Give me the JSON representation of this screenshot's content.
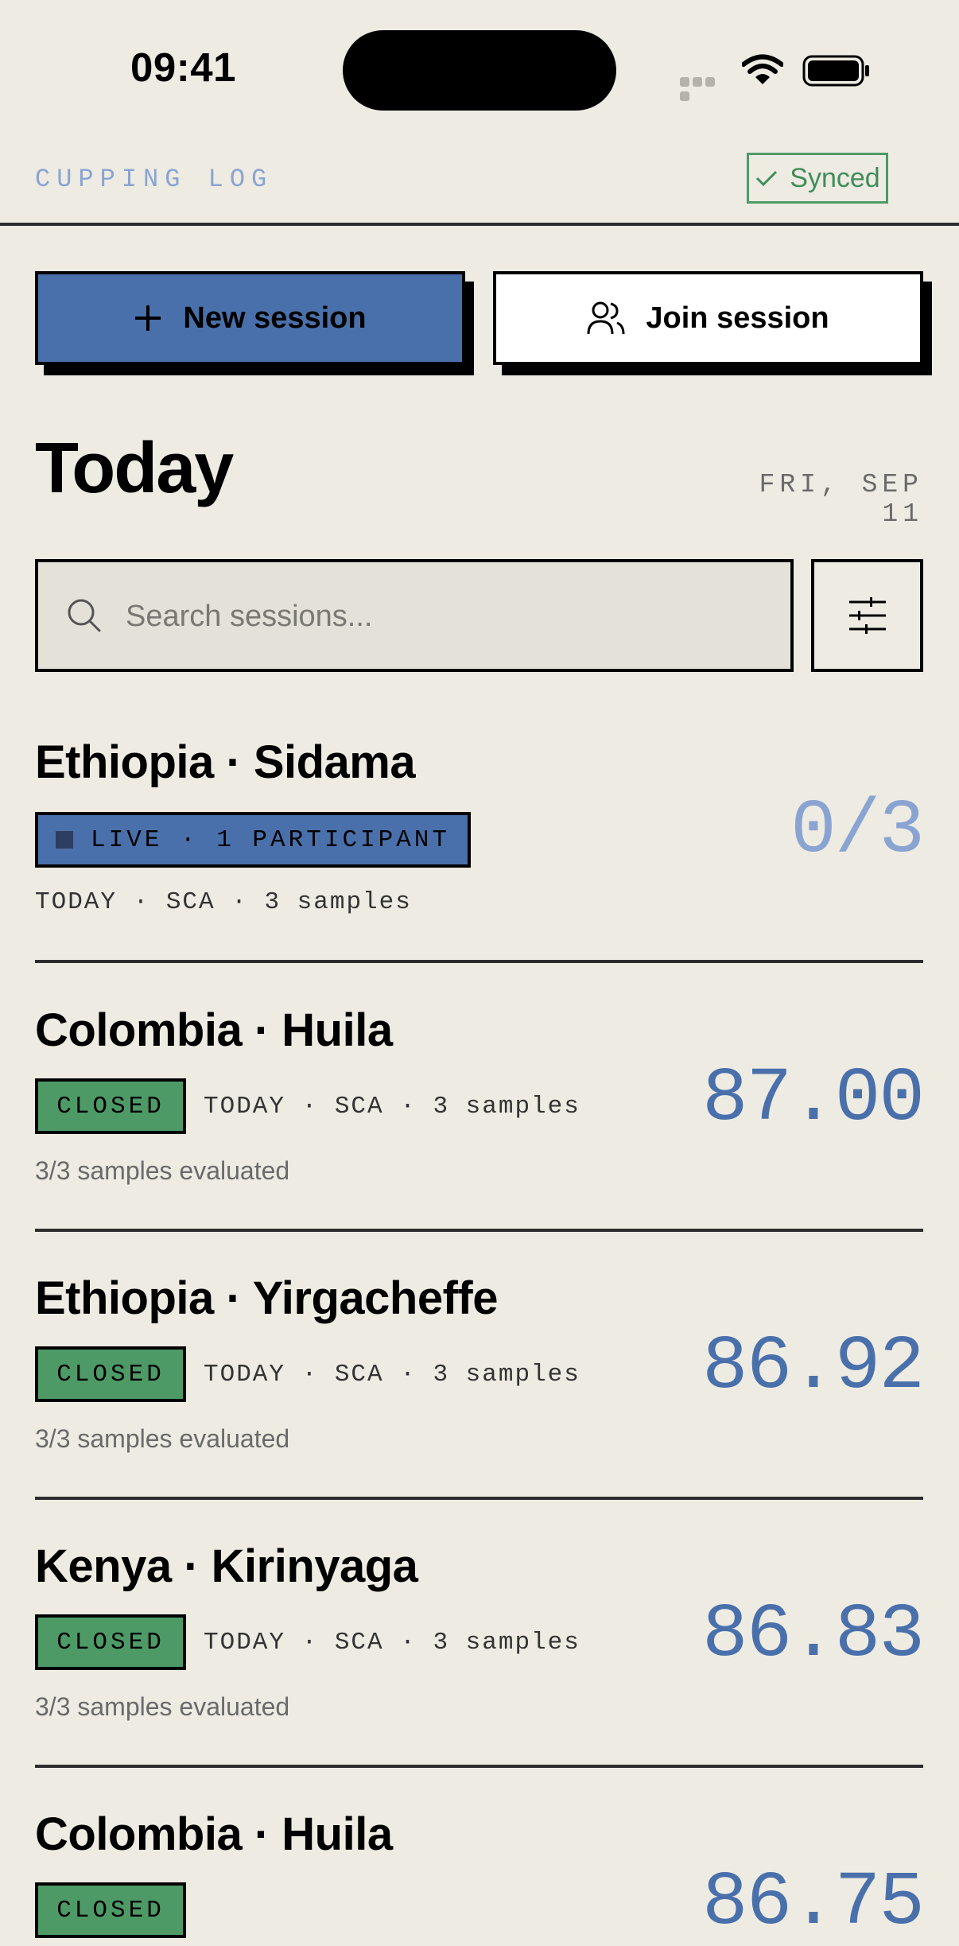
{
  "status_bar": {
    "time": "09:41"
  },
  "header": {
    "app_title": "CUPPING LOG",
    "sync_status": "Synced"
  },
  "actions": {
    "new_session_label": "New session",
    "join_session_label": "Join session"
  },
  "today": {
    "title": "Today",
    "date": "FRI, SEP 11"
  },
  "search": {
    "placeholder": "Search sessions..."
  },
  "sessions": [
    {
      "title": "Ethiopia · Sidama",
      "status": "LIVE · 1 PARTICIPANT",
      "meta": "TODAY · SCA · 3 samples",
      "score": "0/3"
    },
    {
      "title": "Colombia · Huila",
      "status": "CLOSED",
      "meta": "TODAY · SCA · 3 samples",
      "evaluated": "3/3 samples evaluated",
      "score": "87.00"
    },
    {
      "title": "Ethiopia · Yirgacheffe",
      "status": "CLOSED",
      "meta": "TODAY · SCA · 3 samples",
      "evaluated": "3/3 samples evaluated",
      "score": "86.92"
    },
    {
      "title": "Kenya · Kirinyaga",
      "status": "CLOSED",
      "meta": "TODAY · SCA · 3 samples",
      "evaluated": "3/3 samples evaluated",
      "score": "86.83"
    },
    {
      "title": "Colombia · Huila",
      "status": "CLOSED",
      "score": "86.75"
    }
  ],
  "colors": {
    "background": "#eeebe3",
    "accent_blue": "#4a70ab",
    "light_blue": "#8aa4d2",
    "closed_green": "#4e9a67"
  },
  "icons": [
    "wifi-icon",
    "battery-icon",
    "check-icon",
    "plus-icon",
    "users-icon",
    "search-icon",
    "sliders-icon"
  ]
}
